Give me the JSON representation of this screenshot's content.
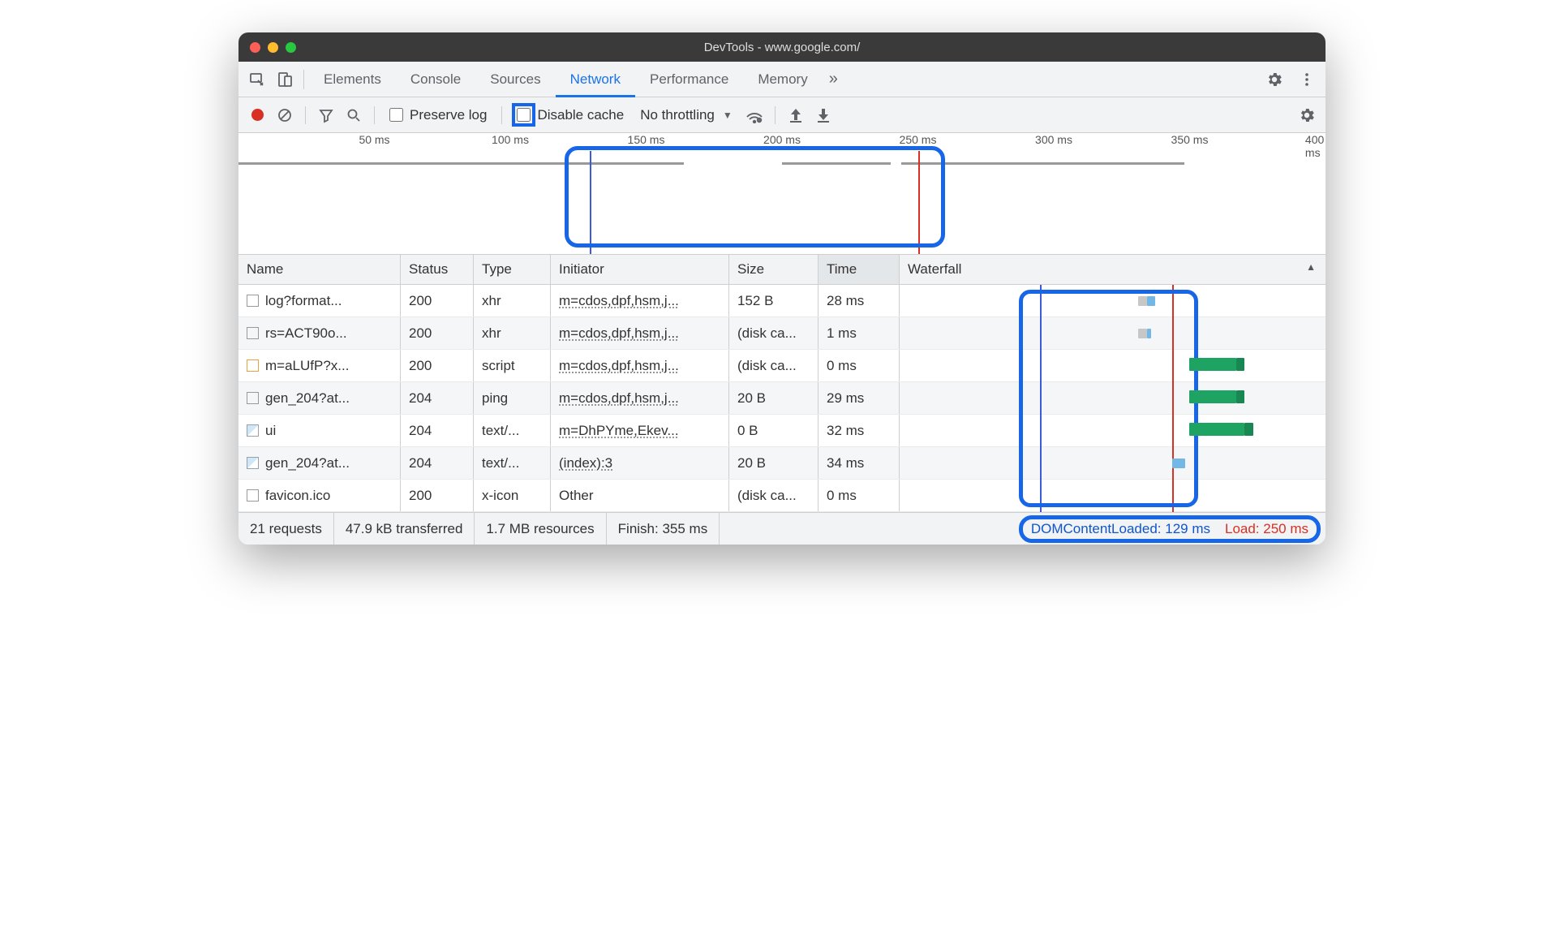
{
  "window": {
    "title": "DevTools - www.google.com/"
  },
  "tabs": {
    "items": [
      "Elements",
      "Console",
      "Sources",
      "Network",
      "Performance",
      "Memory"
    ],
    "active": "Network",
    "more": "»"
  },
  "toolbar": {
    "preserve_log": "Preserve log",
    "disable_cache": "Disable cache",
    "throttling": "No throttling"
  },
  "overview": {
    "ticks": [
      "50 ms",
      "100 ms",
      "150 ms",
      "200 ms",
      "250 ms",
      "300 ms",
      "350 ms",
      "400 ms"
    ]
  },
  "columns": {
    "name": "Name",
    "status": "Status",
    "type": "Type",
    "initiator": "Initiator",
    "size": "Size",
    "time": "Time",
    "waterfall": "Waterfall"
  },
  "rows": [
    {
      "icon": "doc",
      "name": "log?format...",
      "status": "200",
      "type": "xhr",
      "initiator": "m=cdos,dpf,hsm,j...",
      "size": "152 B",
      "time": "28 ms"
    },
    {
      "icon": "doc",
      "name": "rs=ACT90o...",
      "status": "200",
      "type": "xhr",
      "initiator": "m=cdos,dpf,hsm,j...",
      "size": "(disk ca...",
      "time": "1 ms"
    },
    {
      "icon": "js",
      "name": "m=aLUfP?x...",
      "status": "200",
      "type": "script",
      "initiator": "m=cdos,dpf,hsm,j...",
      "size": "(disk ca...",
      "time": "0 ms"
    },
    {
      "icon": "doc",
      "name": "gen_204?at...",
      "status": "204",
      "type": "ping",
      "initiator": "m=cdos,dpf,hsm,j...",
      "size": "20 B",
      "time": "29 ms"
    },
    {
      "icon": "img",
      "name": "ui",
      "status": "204",
      "type": "text/...",
      "initiator": "m=DhPYme,Ekev...",
      "size": "0 B",
      "time": "32 ms"
    },
    {
      "icon": "img",
      "name": "gen_204?at...",
      "status": "204",
      "type": "text/...",
      "initiator": "(index):3",
      "size": "20 B",
      "time": "34 ms"
    },
    {
      "icon": "doc",
      "name": "favicon.ico",
      "status": "200",
      "type": "x-icon",
      "initiator": "Other",
      "size": "(disk ca...",
      "time": "0 ms",
      "initiator_link": false
    }
  ],
  "status": {
    "requests": "21 requests",
    "transferred": "47.9 kB transferred",
    "resources": "1.7 MB resources",
    "finish": "Finish: 355 ms",
    "dcl": "DOMContentLoaded: 129 ms",
    "load": "Load: 250 ms"
  }
}
